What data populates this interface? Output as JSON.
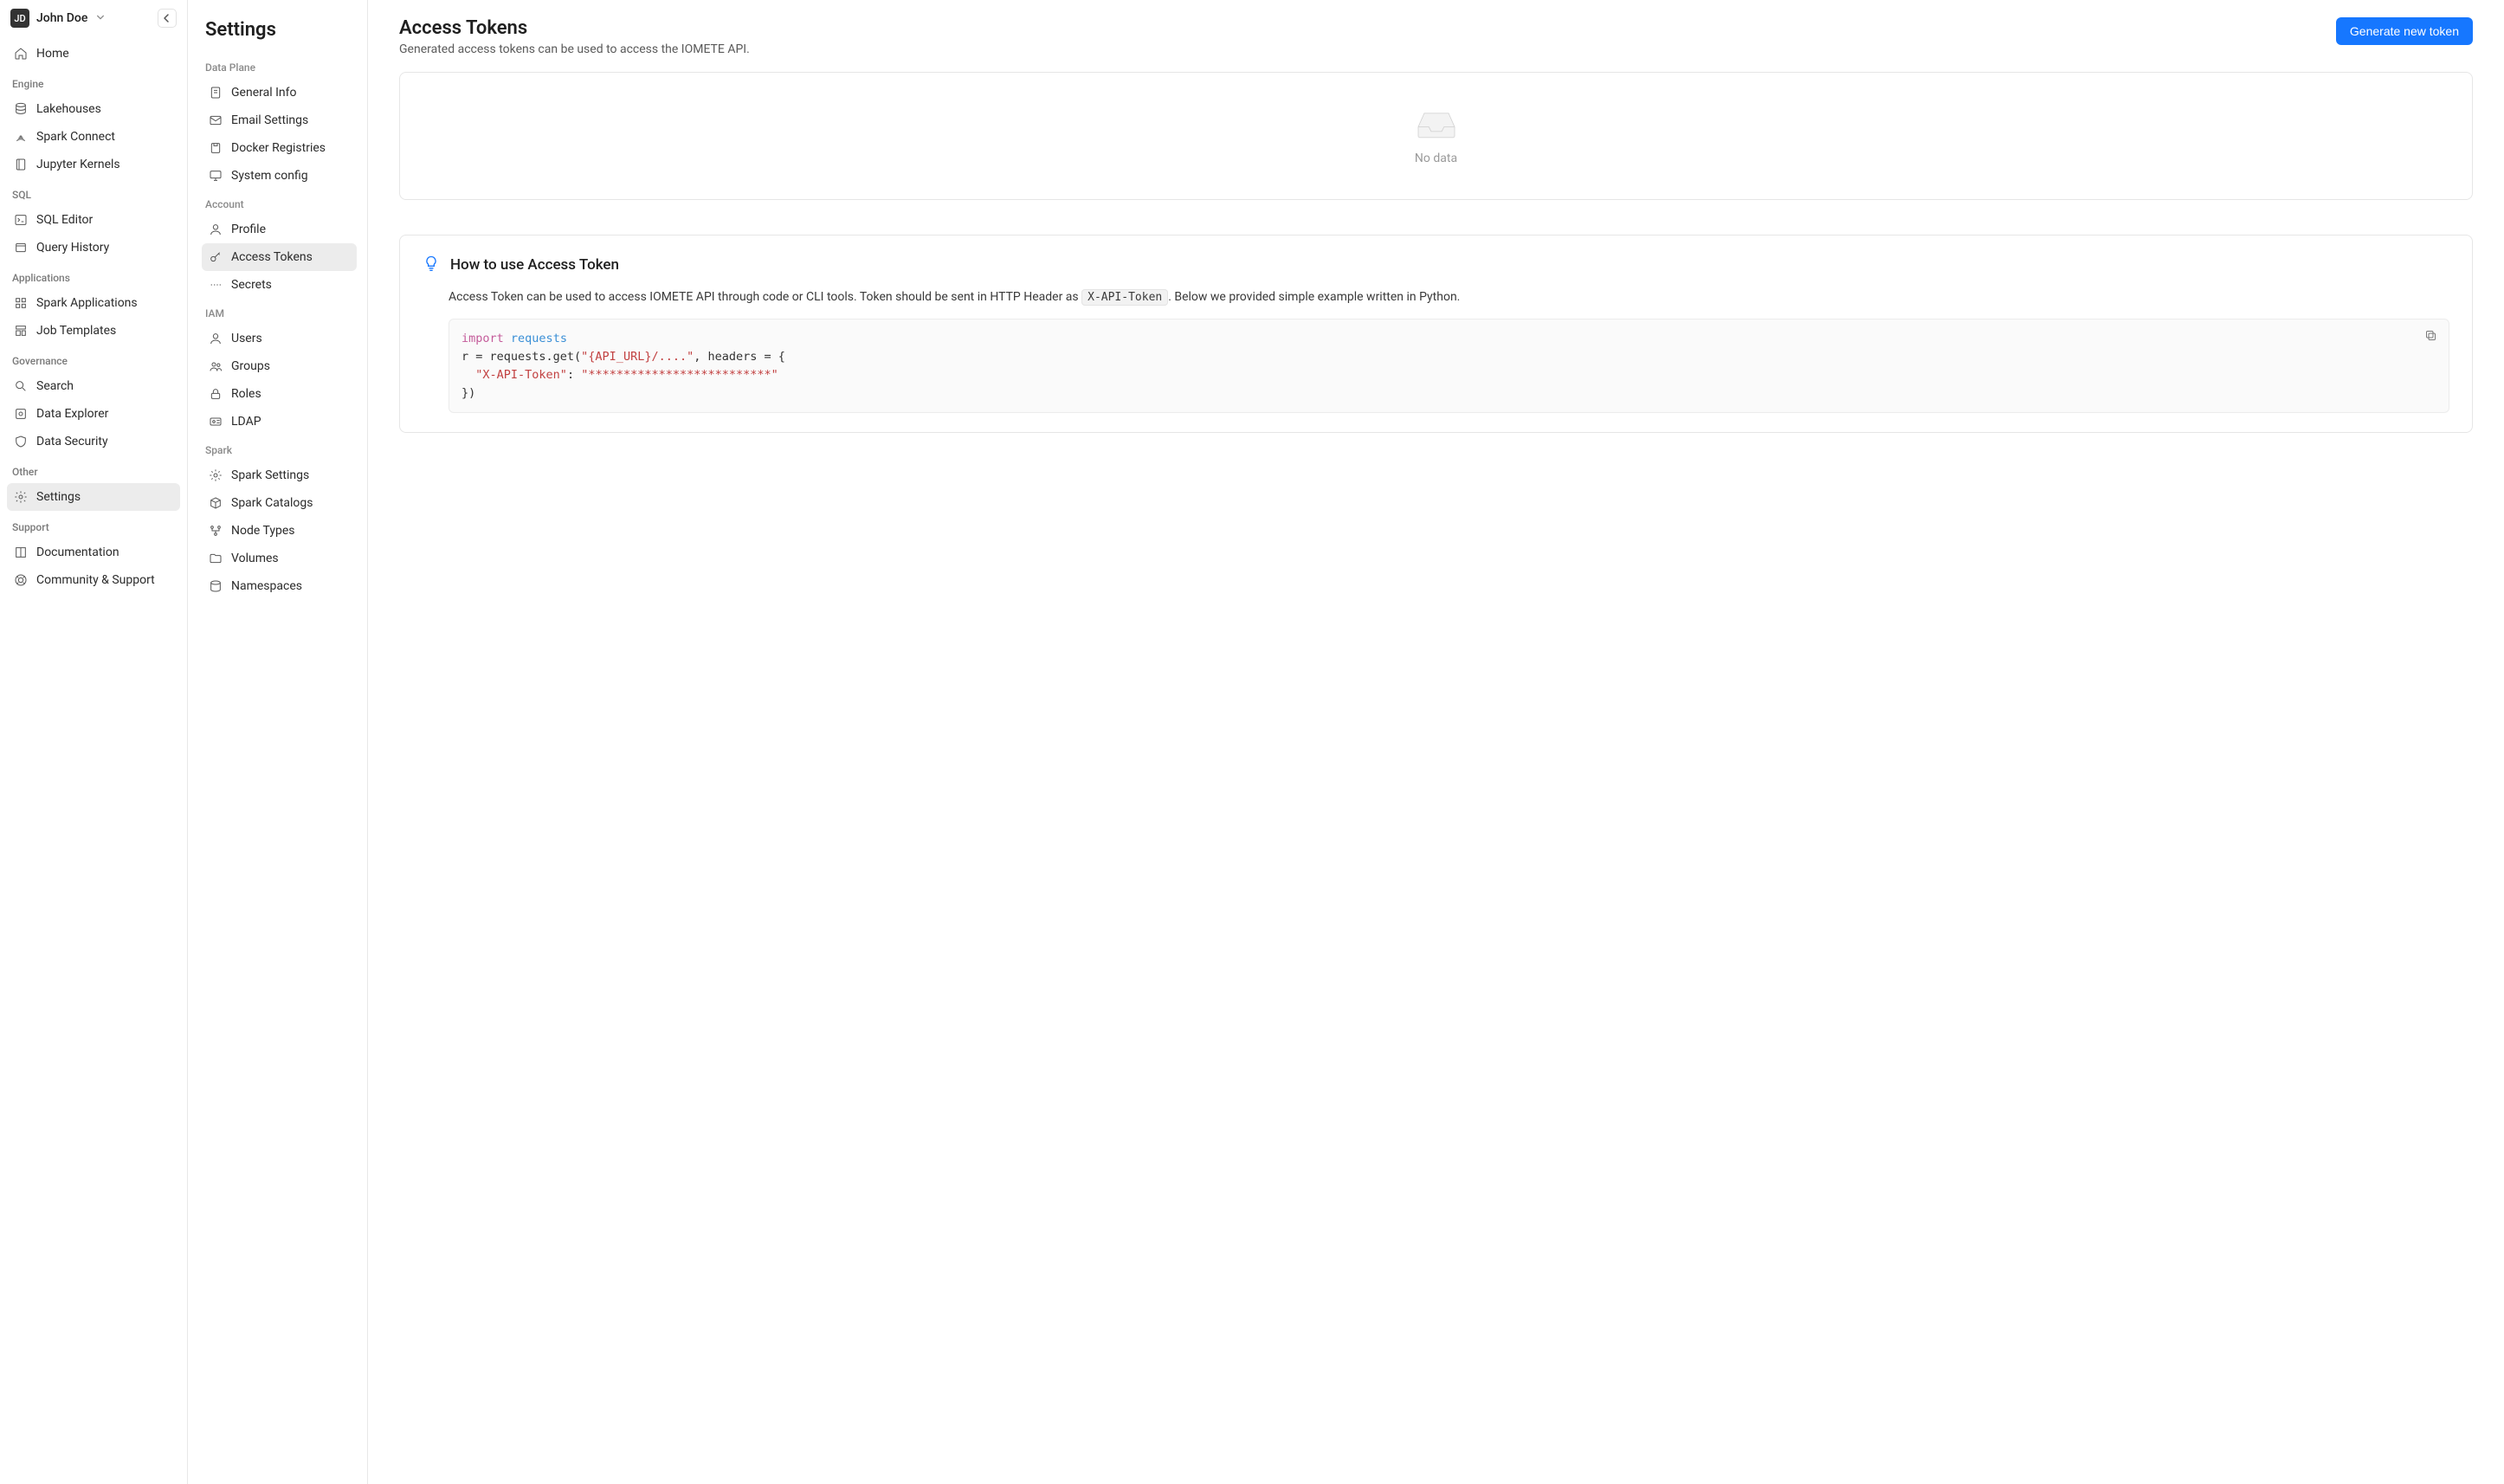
{
  "user": {
    "initials": "JD",
    "name": "John Doe"
  },
  "primaryNav": {
    "home": "Home",
    "sections": [
      {
        "label": "Engine",
        "items": [
          {
            "id": "lakehouses",
            "label": "Lakehouses"
          },
          {
            "id": "spark-connect",
            "label": "Spark Connect"
          },
          {
            "id": "jupyter-kernels",
            "label": "Jupyter Kernels"
          }
        ]
      },
      {
        "label": "SQL",
        "items": [
          {
            "id": "sql-editor",
            "label": "SQL Editor"
          },
          {
            "id": "query-history",
            "label": "Query History"
          }
        ]
      },
      {
        "label": "Applications",
        "items": [
          {
            "id": "spark-applications",
            "label": "Spark Applications"
          },
          {
            "id": "job-templates",
            "label": "Job Templates"
          }
        ]
      },
      {
        "label": "Governance",
        "items": [
          {
            "id": "search",
            "label": "Search"
          },
          {
            "id": "data-explorer",
            "label": "Data Explorer"
          },
          {
            "id": "data-security",
            "label": "Data Security"
          }
        ]
      },
      {
        "label": "Other",
        "items": [
          {
            "id": "settings",
            "label": "Settings",
            "active": true
          }
        ]
      },
      {
        "label": "Support",
        "items": [
          {
            "id": "documentation",
            "label": "Documentation"
          },
          {
            "id": "community-support",
            "label": "Community & Support"
          }
        ]
      }
    ]
  },
  "settingsPanel": {
    "title": "Settings",
    "groups": [
      {
        "label": "Data Plane",
        "items": [
          {
            "id": "general-info",
            "label": "General Info"
          },
          {
            "id": "email-settings",
            "label": "Email Settings"
          },
          {
            "id": "docker-registries",
            "label": "Docker Registries"
          },
          {
            "id": "system-config",
            "label": "System config"
          }
        ]
      },
      {
        "label": "Account",
        "items": [
          {
            "id": "profile",
            "label": "Profile"
          },
          {
            "id": "access-tokens",
            "label": "Access Tokens",
            "active": true
          },
          {
            "id": "secrets",
            "label": "Secrets"
          }
        ]
      },
      {
        "label": "IAM",
        "items": [
          {
            "id": "users",
            "label": "Users"
          },
          {
            "id": "groups",
            "label": "Groups"
          },
          {
            "id": "roles",
            "label": "Roles"
          },
          {
            "id": "ldap",
            "label": "LDAP"
          }
        ]
      },
      {
        "label": "Spark",
        "items": [
          {
            "id": "spark-settings",
            "label": "Spark Settings"
          },
          {
            "id": "spark-catalogs",
            "label": "Spark Catalogs"
          },
          {
            "id": "node-types",
            "label": "Node Types"
          },
          {
            "id": "volumes",
            "label": "Volumes"
          },
          {
            "id": "namespaces",
            "label": "Namespaces"
          }
        ]
      }
    ]
  },
  "main": {
    "title": "Access Tokens",
    "subtitle": "Generated access tokens can be used to access the IOMETE API.",
    "generateBtn": "Generate new token",
    "emptyText": "No data",
    "help": {
      "title": "How to use Access Token",
      "body_pre": "Access Token can be used to access IOMETE API through code or CLI tools. Token should be sent in HTTP Header as ",
      "header_token": "X-API-Token",
      "body_post": ". Below we provided simple example written in Python.",
      "code": {
        "kw_import": "import",
        "mod_requests": "requests",
        "line2_prefix": "r = requests.get(",
        "str_url": "\"{API_URL}/....\"",
        "line2_mid": ", headers = {",
        "str_header_key": "\"X-API-Token\"",
        "colon": ": ",
        "str_header_val": "\"**************************\"",
        "line4": "})"
      }
    }
  }
}
